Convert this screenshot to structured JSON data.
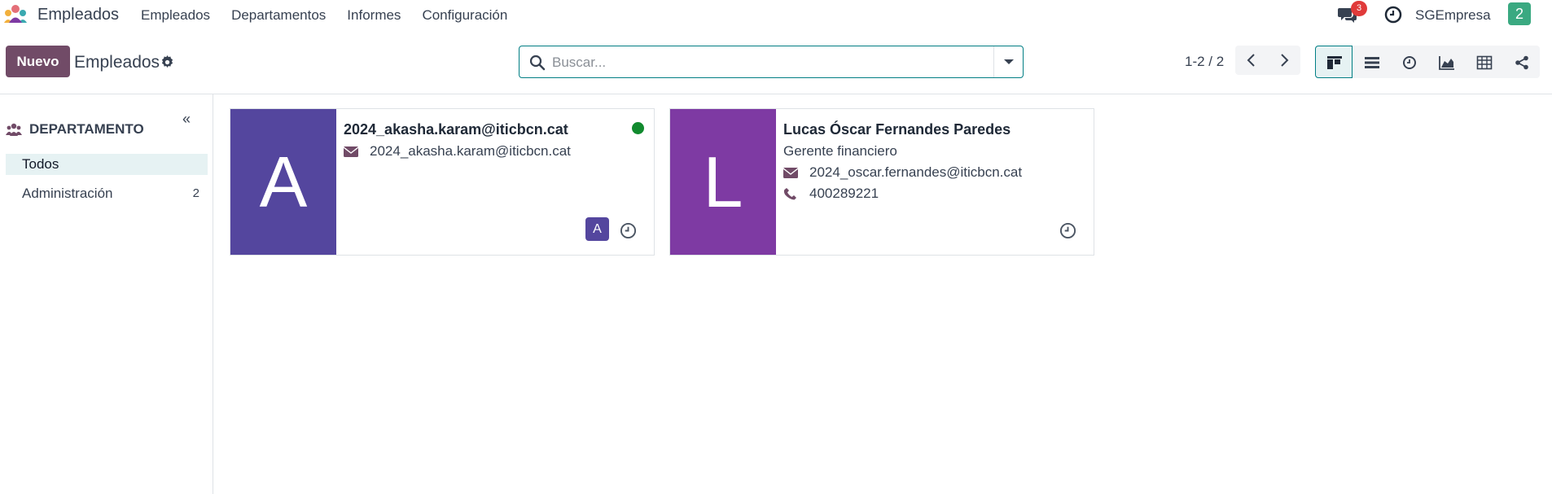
{
  "navbar": {
    "app_name": "Empleados",
    "menu": [
      "Empleados",
      "Departamentos",
      "Informes",
      "Configuración"
    ],
    "chat_badge": "3",
    "company": "SGEmpresa",
    "user_initial": "2"
  },
  "control_panel": {
    "new_label": "Nuevo",
    "title": "Empleados",
    "search_placeholder": "Buscar...",
    "pager": "1-2 / 2",
    "views": [
      "kanban-icon",
      "list-icon",
      "activity-icon",
      "graph-icon",
      "pivot-icon",
      "hierarchy-icon"
    ],
    "active_view": "kanban"
  },
  "sidebar": {
    "title": "DEPARTAMENTO",
    "items": [
      {
        "label": "Todos",
        "count": ""
      },
      {
        "label": "Administración",
        "count": "2"
      }
    ]
  },
  "employees": [
    {
      "initial": "A",
      "avatar_color": "#54469e",
      "name": "2024_akasha.karam@iticbcn.cat",
      "job_title": "",
      "email": "2024_akasha.karam@iticbcn.cat",
      "phone": "",
      "online": true,
      "user_initial": "A"
    },
    {
      "initial": "L",
      "avatar_color": "#7e3aa3",
      "name": "Lucas Óscar Fernandes Paredes",
      "job_title": "Gerente financiero",
      "email": "2024_oscar.fernandes@iticbcn.cat",
      "phone": "400289221",
      "online": false,
      "user_initial": ""
    }
  ],
  "colors": {
    "primary": "#714b67",
    "accent": "#017e84",
    "online": "#118a2e",
    "badge": "#e03a3a"
  }
}
